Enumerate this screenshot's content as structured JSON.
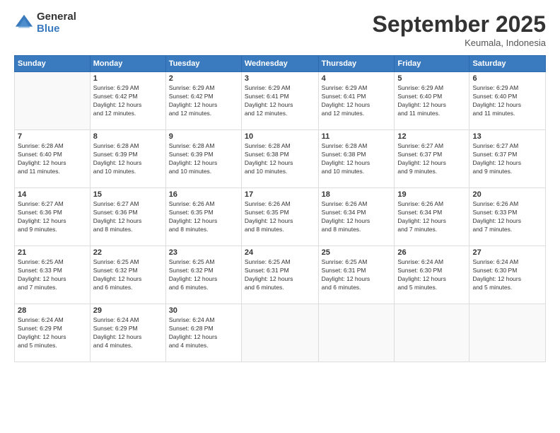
{
  "logo": {
    "general": "General",
    "blue": "Blue"
  },
  "header": {
    "title": "September 2025",
    "location": "Keumala, Indonesia"
  },
  "days_of_week": [
    "Sunday",
    "Monday",
    "Tuesday",
    "Wednesday",
    "Thursday",
    "Friday",
    "Saturday"
  ],
  "weeks": [
    [
      {
        "day": "",
        "info": ""
      },
      {
        "day": "1",
        "info": "Sunrise: 6:29 AM\nSunset: 6:42 PM\nDaylight: 12 hours\nand 12 minutes."
      },
      {
        "day": "2",
        "info": "Sunrise: 6:29 AM\nSunset: 6:42 PM\nDaylight: 12 hours\nand 12 minutes."
      },
      {
        "day": "3",
        "info": "Sunrise: 6:29 AM\nSunset: 6:41 PM\nDaylight: 12 hours\nand 12 minutes."
      },
      {
        "day": "4",
        "info": "Sunrise: 6:29 AM\nSunset: 6:41 PM\nDaylight: 12 hours\nand 12 minutes."
      },
      {
        "day": "5",
        "info": "Sunrise: 6:29 AM\nSunset: 6:40 PM\nDaylight: 12 hours\nand 11 minutes."
      },
      {
        "day": "6",
        "info": "Sunrise: 6:29 AM\nSunset: 6:40 PM\nDaylight: 12 hours\nand 11 minutes."
      }
    ],
    [
      {
        "day": "7",
        "info": "Sunrise: 6:28 AM\nSunset: 6:40 PM\nDaylight: 12 hours\nand 11 minutes."
      },
      {
        "day": "8",
        "info": "Sunrise: 6:28 AM\nSunset: 6:39 PM\nDaylight: 12 hours\nand 10 minutes."
      },
      {
        "day": "9",
        "info": "Sunrise: 6:28 AM\nSunset: 6:39 PM\nDaylight: 12 hours\nand 10 minutes."
      },
      {
        "day": "10",
        "info": "Sunrise: 6:28 AM\nSunset: 6:38 PM\nDaylight: 12 hours\nand 10 minutes."
      },
      {
        "day": "11",
        "info": "Sunrise: 6:28 AM\nSunset: 6:38 PM\nDaylight: 12 hours\nand 10 minutes."
      },
      {
        "day": "12",
        "info": "Sunrise: 6:27 AM\nSunset: 6:37 PM\nDaylight: 12 hours\nand 9 minutes."
      },
      {
        "day": "13",
        "info": "Sunrise: 6:27 AM\nSunset: 6:37 PM\nDaylight: 12 hours\nand 9 minutes."
      }
    ],
    [
      {
        "day": "14",
        "info": "Sunrise: 6:27 AM\nSunset: 6:36 PM\nDaylight: 12 hours\nand 9 minutes."
      },
      {
        "day": "15",
        "info": "Sunrise: 6:27 AM\nSunset: 6:36 PM\nDaylight: 12 hours\nand 8 minutes."
      },
      {
        "day": "16",
        "info": "Sunrise: 6:26 AM\nSunset: 6:35 PM\nDaylight: 12 hours\nand 8 minutes."
      },
      {
        "day": "17",
        "info": "Sunrise: 6:26 AM\nSunset: 6:35 PM\nDaylight: 12 hours\nand 8 minutes."
      },
      {
        "day": "18",
        "info": "Sunrise: 6:26 AM\nSunset: 6:34 PM\nDaylight: 12 hours\nand 8 minutes."
      },
      {
        "day": "19",
        "info": "Sunrise: 6:26 AM\nSunset: 6:34 PM\nDaylight: 12 hours\nand 7 minutes."
      },
      {
        "day": "20",
        "info": "Sunrise: 6:26 AM\nSunset: 6:33 PM\nDaylight: 12 hours\nand 7 minutes."
      }
    ],
    [
      {
        "day": "21",
        "info": "Sunrise: 6:25 AM\nSunset: 6:33 PM\nDaylight: 12 hours\nand 7 minutes."
      },
      {
        "day": "22",
        "info": "Sunrise: 6:25 AM\nSunset: 6:32 PM\nDaylight: 12 hours\nand 6 minutes."
      },
      {
        "day": "23",
        "info": "Sunrise: 6:25 AM\nSunset: 6:32 PM\nDaylight: 12 hours\nand 6 minutes."
      },
      {
        "day": "24",
        "info": "Sunrise: 6:25 AM\nSunset: 6:31 PM\nDaylight: 12 hours\nand 6 minutes."
      },
      {
        "day": "25",
        "info": "Sunrise: 6:25 AM\nSunset: 6:31 PM\nDaylight: 12 hours\nand 6 minutes."
      },
      {
        "day": "26",
        "info": "Sunrise: 6:24 AM\nSunset: 6:30 PM\nDaylight: 12 hours\nand 5 minutes."
      },
      {
        "day": "27",
        "info": "Sunrise: 6:24 AM\nSunset: 6:30 PM\nDaylight: 12 hours\nand 5 minutes."
      }
    ],
    [
      {
        "day": "28",
        "info": "Sunrise: 6:24 AM\nSunset: 6:29 PM\nDaylight: 12 hours\nand 5 minutes."
      },
      {
        "day": "29",
        "info": "Sunrise: 6:24 AM\nSunset: 6:29 PM\nDaylight: 12 hours\nand 4 minutes."
      },
      {
        "day": "30",
        "info": "Sunrise: 6:24 AM\nSunset: 6:28 PM\nDaylight: 12 hours\nand 4 minutes."
      },
      {
        "day": "",
        "info": ""
      },
      {
        "day": "",
        "info": ""
      },
      {
        "day": "",
        "info": ""
      },
      {
        "day": "",
        "info": ""
      }
    ]
  ]
}
